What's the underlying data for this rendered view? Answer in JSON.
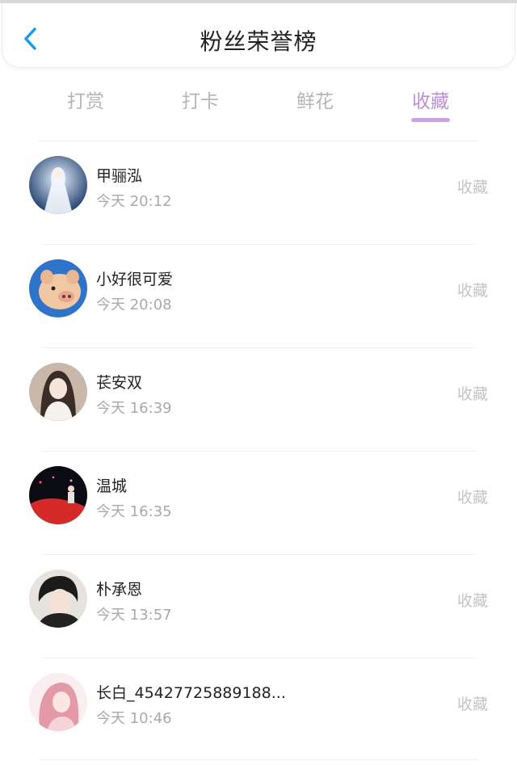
{
  "header": {
    "title": "粉丝荣誉榜",
    "back_icon": "chevron-left-icon",
    "accent": "#1a9be8"
  },
  "tabs": [
    {
      "label": "打赏",
      "active": false
    },
    {
      "label": "打卡",
      "active": false
    },
    {
      "label": "鲜花",
      "active": false
    },
    {
      "label": "收藏",
      "active": true
    }
  ],
  "colors": {
    "active_tab": "#b98fd6",
    "inactive_tab": "#b5b5b5",
    "time": "#a9a9a9",
    "type_label": "#c4c4c4"
  },
  "fans": [
    {
      "name": "甲骊泓",
      "time": "今天 20:12",
      "type": "收藏"
    },
    {
      "name": "小好很可爱",
      "time": "今天 20:08",
      "type": "收藏"
    },
    {
      "name": "苌安双",
      "time": "今天 16:39",
      "type": "收藏"
    },
    {
      "name": "温城",
      "time": "今天 16:35",
      "type": "收藏"
    },
    {
      "name": "朴承恩",
      "time": "今天 13:57",
      "type": "收藏"
    },
    {
      "name": "长白_45427725889188...",
      "time": "今天 10:46",
      "type": "收藏"
    }
  ]
}
